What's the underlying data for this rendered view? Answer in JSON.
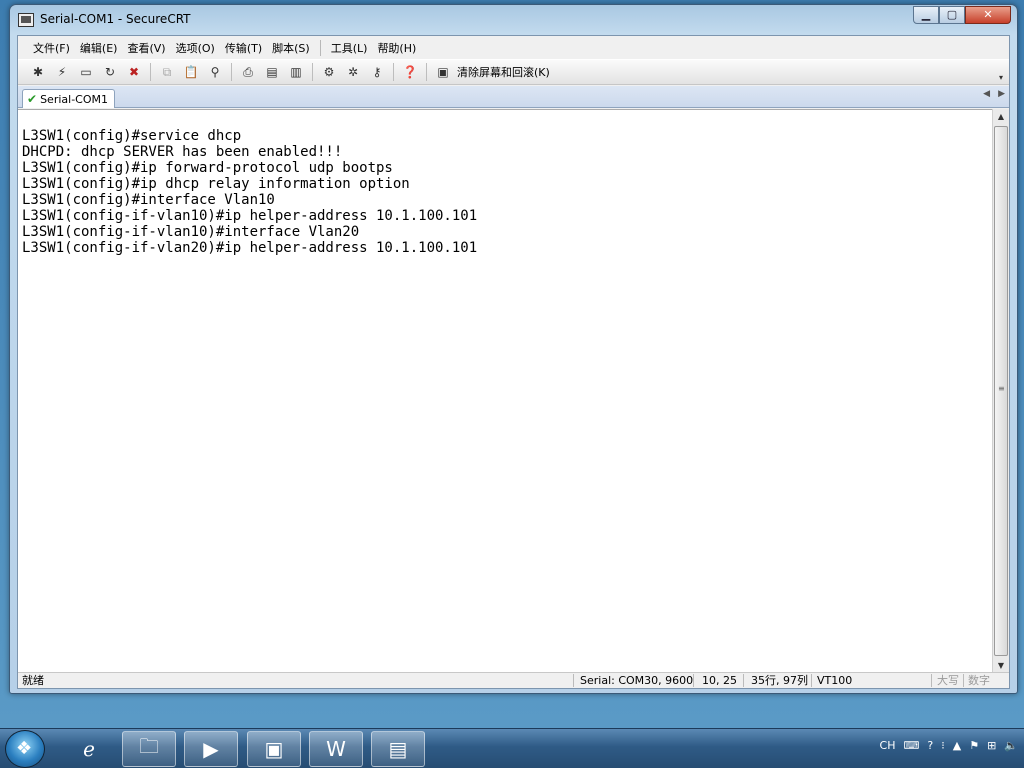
{
  "window": {
    "title": "Serial-COM1 - SecureCRT"
  },
  "menu": [
    "文件(F)",
    "编辑(E)",
    "查看(V)",
    "选项(O)",
    "传输(T)",
    "脚本(S)",
    "工具(L)",
    "帮助(H)"
  ],
  "toolbar": {
    "clear_label": "清除屏幕和回滚(K)"
  },
  "tab": {
    "label": "Serial-COM1"
  },
  "terminal": {
    "lines": [
      "L3SW1(config)#service dhcp",
      "DHCPD: dhcp SERVER has been enabled!!!",
      "L3SW1(config)#ip forward-protocol udp bootps",
      "L3SW1(config)#ip dhcp relay information option",
      "L3SW1(config)#interface Vlan10",
      "L3SW1(config-if-vlan10)#ip helper-address 10.1.100.101",
      "L3SW1(config-if-vlan10)#interface Vlan20",
      "L3SW1(config-if-vlan20)#ip helper-address 10.1.100.101"
    ]
  },
  "status": {
    "ready": "就绪",
    "connection": "Serial: COM30, 9600",
    "cursor": "10,  25",
    "size": "35行, 97列",
    "emulation": "VT100",
    "caps": "大写",
    "num": "数字"
  },
  "taskbar": {
    "ime": "CH"
  }
}
